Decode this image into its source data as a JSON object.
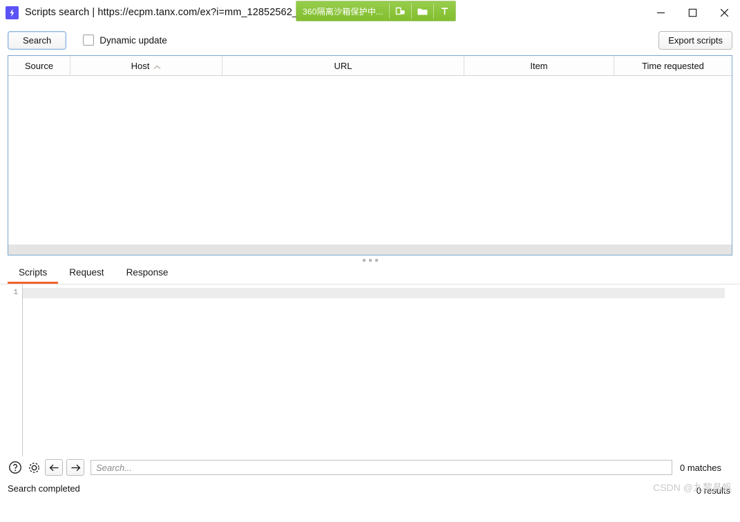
{
  "window": {
    "title": "Scripts search | https://ecpm.tanx.com/ex?i=mm_12852562_88816723674_94&cb=jsonp95",
    "app_icon": "lightning-bolt-icon",
    "controls": {
      "minimize": "minimize-icon",
      "maximize": "maximize-icon",
      "close": "close-icon"
    }
  },
  "sandbox_badge": {
    "label": "360隔离沙箱保护中...",
    "icons": [
      "sandbox-window-icon",
      "folder-icon",
      "pin-icon"
    ],
    "color": "#8cc63e"
  },
  "toolbar": {
    "search_label": "Search",
    "dynamic_update_label": "Dynamic update",
    "dynamic_update_checked": false,
    "export_label": "Export scripts"
  },
  "results_table": {
    "columns": [
      {
        "label": "Source",
        "sorted": false
      },
      {
        "label": "Host",
        "sorted": true,
        "sort_direction": "asc"
      },
      {
        "label": "URL",
        "sorted": false
      },
      {
        "label": "Item",
        "sorted": false
      },
      {
        "label": "Time requested",
        "sorted": false
      }
    ],
    "rows": []
  },
  "detail_tabs": [
    {
      "label": "Scripts",
      "active": true
    },
    {
      "label": "Request",
      "active": false
    },
    {
      "label": "Response",
      "active": false
    }
  ],
  "editor": {
    "line_numbers": [
      "1"
    ],
    "content": ""
  },
  "findbar": {
    "help_icon": "question-mark-icon",
    "settings_icon": "gear-icon",
    "prev_icon": "arrow-left-icon",
    "next_icon": "arrow-right-icon",
    "search_value": "",
    "search_placeholder": "Search...",
    "matches_label": "0 matches"
  },
  "statusbar": {
    "status": "Search completed",
    "results_label": "0 results"
  },
  "watermark": {
    "text": "CSDN @九黎晶帆"
  },
  "theme": {
    "accent": "#f4632a",
    "table_border": "#7ba7cd",
    "badge_green": "#8cc63e",
    "app_icon_bg": "#5b52f5"
  }
}
